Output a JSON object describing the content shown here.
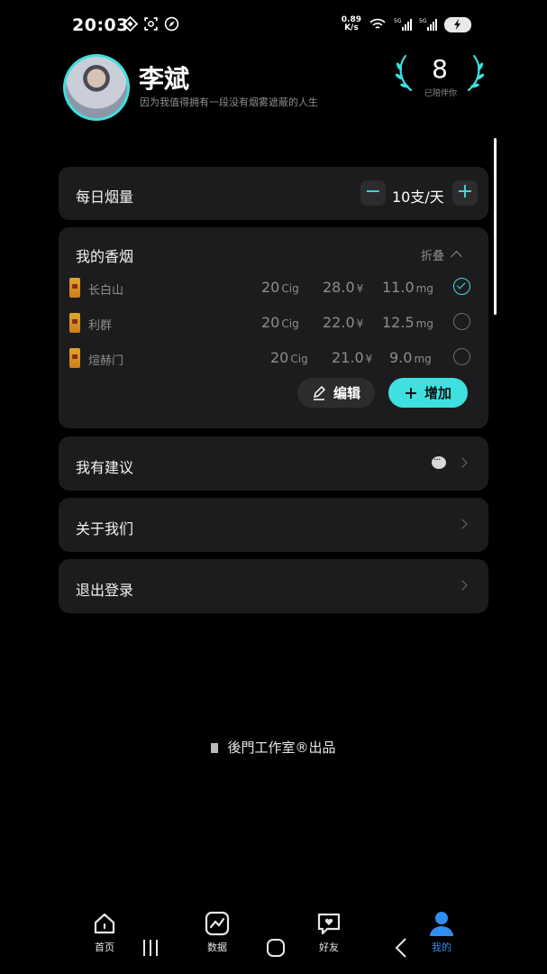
{
  "status_bar": {
    "time": "20:03",
    "speed_value": "0.89",
    "speed_unit": "K/s",
    "network_1": "5G",
    "network_2": "5G"
  },
  "profile": {
    "name": "李斌",
    "bio": "因为我值得拥有一段没有烟雾遮蔽的人生",
    "days_count": "8",
    "days_label": "已陪伴你"
  },
  "daily": {
    "title": "每日烟量",
    "value": "10支/天",
    "minus": "−",
    "plus": "+"
  },
  "cigarettes": {
    "title": "我的香烟",
    "fold_label": "折叠",
    "items": [
      {
        "brand": "长白山",
        "count": "20",
        "count_unit": "Cig",
        "price": "28.0",
        "price_unit": "¥",
        "tar": "11.0",
        "tar_unit": "mg",
        "selected": true
      },
      {
        "brand": "利群",
        "count": "20",
        "count_unit": "Cig",
        "price": "22.0",
        "price_unit": "¥",
        "tar": "12.5",
        "tar_unit": "mg",
        "selected": false
      },
      {
        "brand": "煊赫门",
        "count": "20",
        "count_unit": "Cig",
        "price": "21.0",
        "price_unit": "¥",
        "tar": "9.0",
        "tar_unit": "mg",
        "selected": false
      }
    ],
    "edit_label": "编辑",
    "add_label": "增加"
  },
  "menu": {
    "feedback": "我有建议",
    "about": "关于我们",
    "logout": "退出登录"
  },
  "footer": {
    "studio_text": "後門工作室",
    "registered": "®",
    "produced": "出品"
  },
  "nav": {
    "home": "首页",
    "data": "数据",
    "friends": "好友",
    "mine": "我的"
  },
  "colors": {
    "accent": "#3ee0e0",
    "nav_active": "#2f8ef0",
    "card_bg": "#1c1c1e"
  }
}
